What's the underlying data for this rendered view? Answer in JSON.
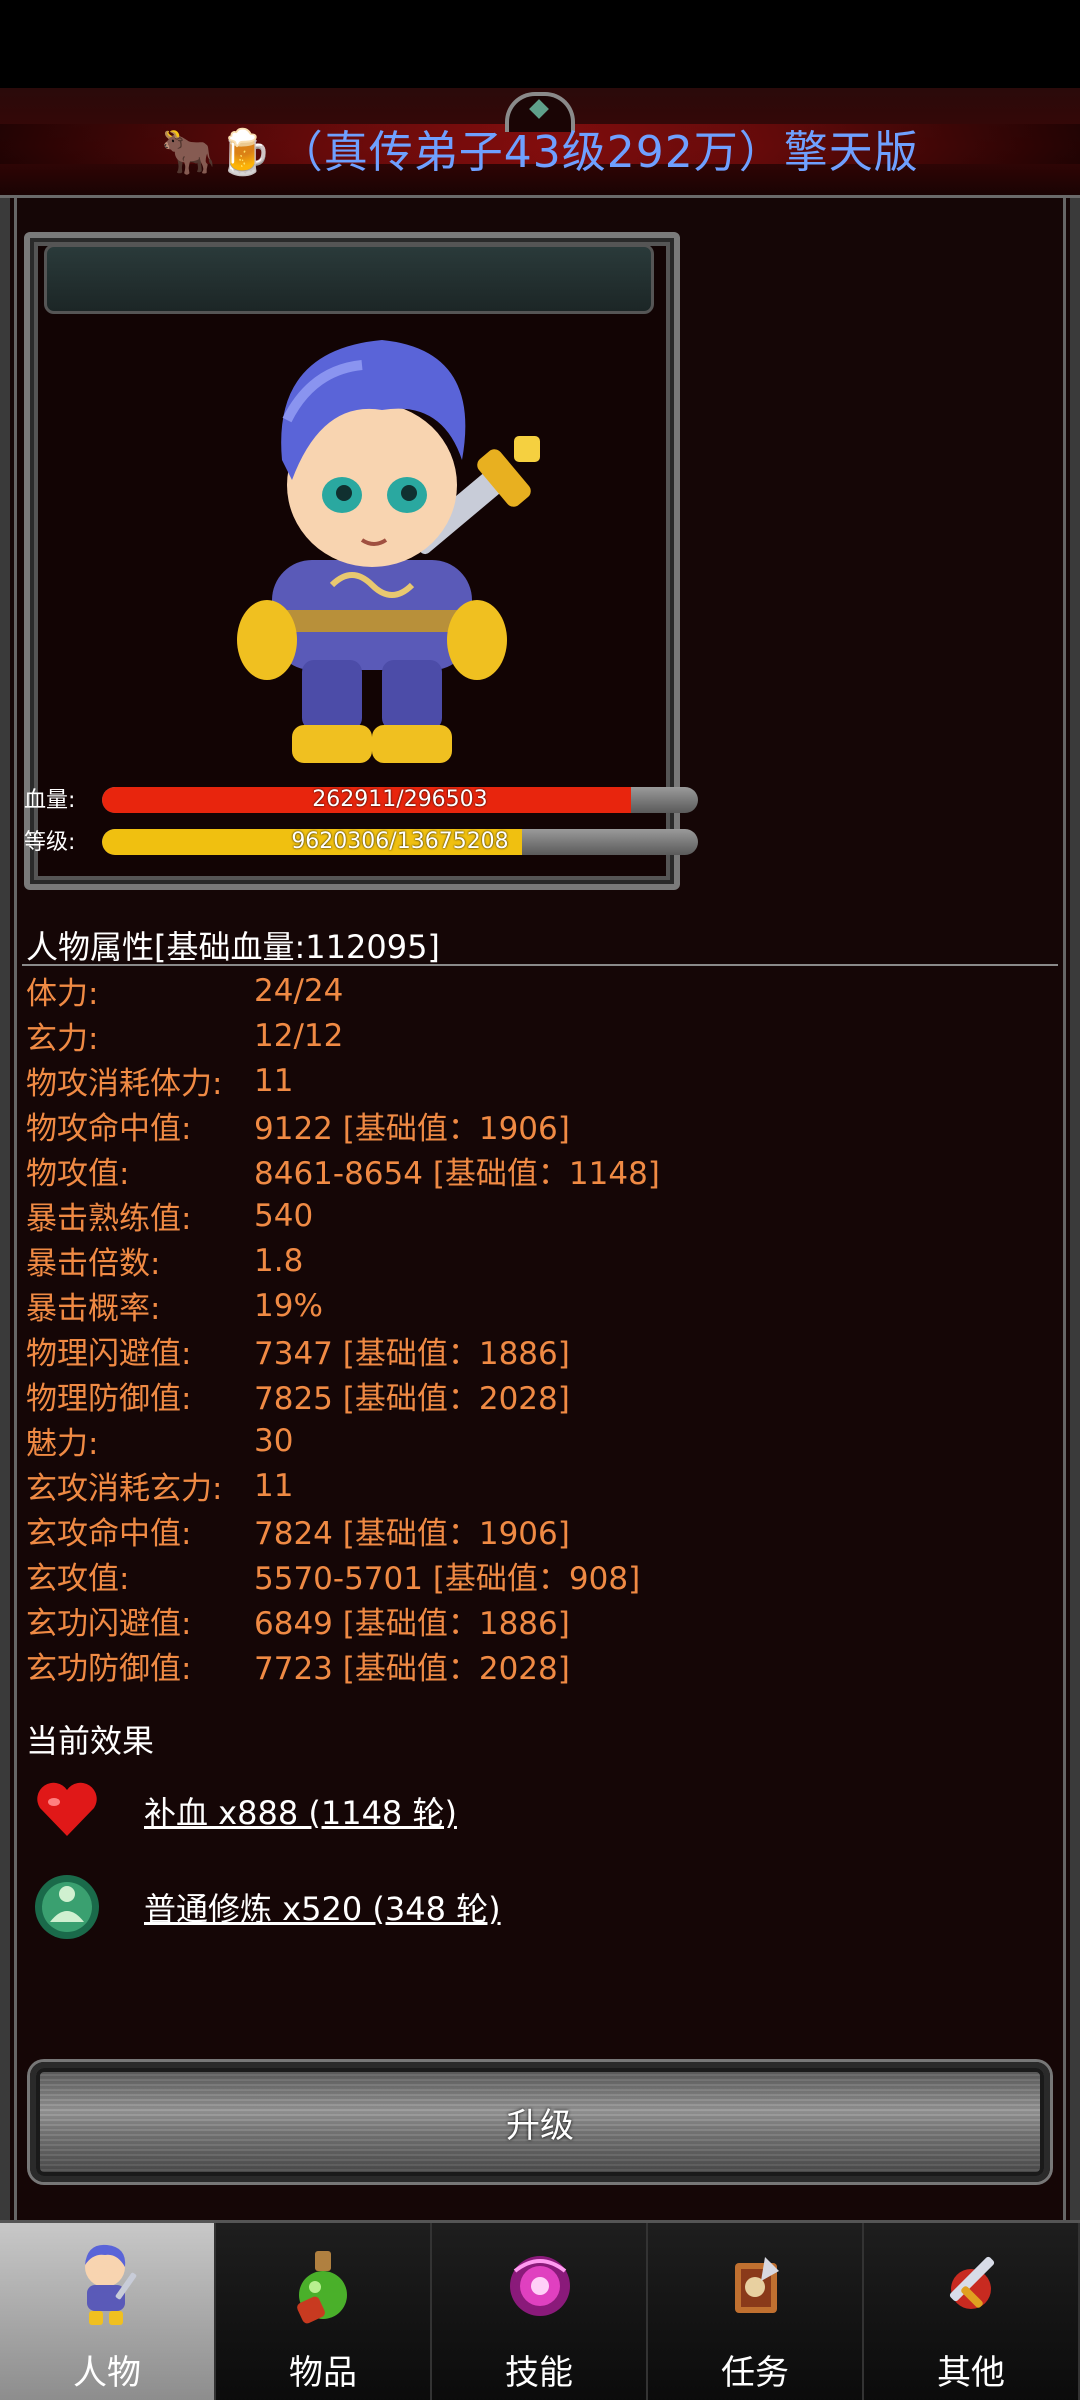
{
  "title": {
    "icons": "🐂🍺",
    "text": "（真传弟子43级292万）擎天版"
  },
  "stats_bars": {
    "hp": {
      "label": "血量:",
      "text": "262911/296503",
      "fraction": 0.887,
      "color": "#e8250d"
    },
    "level": {
      "label": "等级:",
      "text": "9620306/13675208",
      "fraction": 0.704,
      "color": "#f0c010"
    }
  },
  "attributes": {
    "title": "人物属性[基础血量:112095]",
    "rows": [
      {
        "label": "体力:",
        "value": "24/24"
      },
      {
        "label": "玄力:",
        "value": "12/12"
      },
      {
        "label": "物攻消耗体力:",
        "value": "11"
      },
      {
        "label": "物攻命中值:",
        "value": "9122 [基础值：1906]"
      },
      {
        "label": "物攻值:",
        "value": "8461-8654 [基础值：1148]"
      },
      {
        "label": "暴击熟练值:",
        "value": "540"
      },
      {
        "label": "暴击倍数:",
        "value": "1.8"
      },
      {
        "label": "暴击概率:",
        "value": "19%"
      },
      {
        "label": "物理闪避值:",
        "value": "7347 [基础值：1886]"
      },
      {
        "label": "物理防御值:",
        "value": "7825 [基础值：2028]"
      },
      {
        "label": "魅力:",
        "value": "30"
      },
      {
        "label": "玄攻消耗玄力:",
        "value": "11"
      },
      {
        "label": "玄攻命中值:",
        "value": "7824 [基础值：1906]"
      },
      {
        "label": "玄攻值:",
        "value": "5570-5701 [基础值：908]"
      },
      {
        "label": "玄功闪避值:",
        "value": "6849 [基础值：1886]"
      },
      {
        "label": "玄功防御值:",
        "value": "7723 [基础值：2028]"
      }
    ]
  },
  "effects": {
    "title": "当前效果",
    "items": [
      {
        "icon": "heart-icon",
        "text": "补血 x888 (1148 轮)"
      },
      {
        "icon": "meditation-icon",
        "text": "普通修炼 x520 (348 轮)"
      }
    ]
  },
  "upgrade_button": {
    "label": "升级"
  },
  "tabs": [
    {
      "label": "人物",
      "icon": "character-icon",
      "active": true
    },
    {
      "label": "物品",
      "icon": "potion-icon",
      "active": false
    },
    {
      "label": "技能",
      "icon": "skill-orb-icon",
      "active": false
    },
    {
      "label": "任务",
      "icon": "quest-icon",
      "active": false
    },
    {
      "label": "其他",
      "icon": "sword-icon",
      "active": false
    }
  ]
}
